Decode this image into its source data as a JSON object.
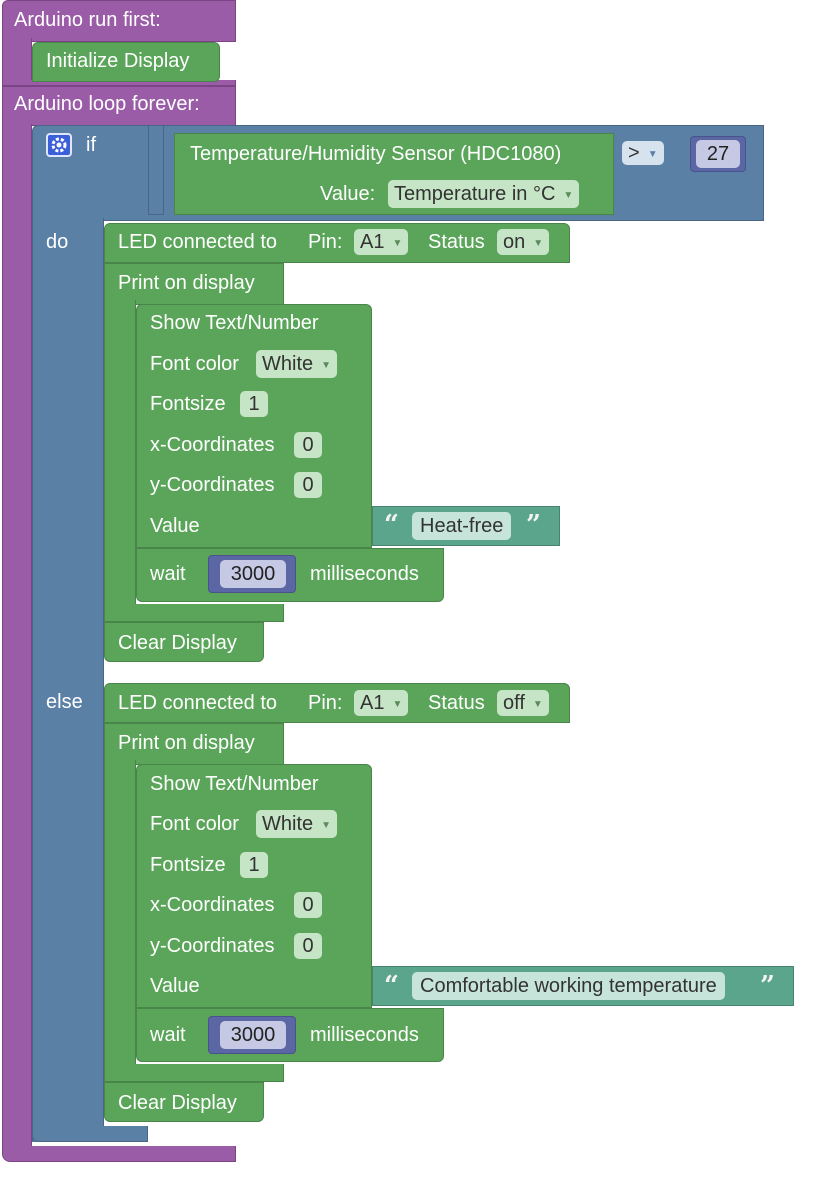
{
  "setup": {
    "label": "Arduino run first:",
    "init_label": "Initialize Display"
  },
  "loop": {
    "label": "Arduino loop forever:"
  },
  "if_block": {
    "if_label": "if",
    "do_label": "do",
    "else_label": "else",
    "condition": {
      "sensor_label": "Temperature/Humidity Sensor (HDC1080)",
      "value_label": "Value:",
      "value_option": "Temperature in °C",
      "operator": ">",
      "threshold": "27"
    }
  },
  "do_branch": {
    "led": {
      "label": "LED connected to",
      "pin_label": "Pin:",
      "pin": "A1",
      "status_label": "Status",
      "status": "on"
    },
    "print_label": "Print on display",
    "show": {
      "label": "Show Text/Number",
      "font_color_label": "Font color",
      "font_color": "White",
      "fontsize_label": "Fontsize",
      "fontsize": "1",
      "x_label": "x-Coordinates",
      "x": "0",
      "y_label": "y-Coordinates",
      "y": "0",
      "value_label": "Value",
      "text": "Heat-free"
    },
    "wait": {
      "label": "wait",
      "ms": "3000",
      "unit": "milliseconds"
    },
    "clear_label": "Clear Display"
  },
  "else_branch": {
    "led": {
      "label": "LED connected to",
      "pin_label": "Pin:",
      "pin": "A1",
      "status_label": "Status",
      "status": "off"
    },
    "print_label": "Print on display",
    "show": {
      "label": "Show Text/Number",
      "font_color_label": "Font color",
      "font_color": "White",
      "fontsize_label": "Fontsize",
      "fontsize": "1",
      "x_label": "x-Coordinates",
      "x": "0",
      "y_label": "y-Coordinates",
      "y": "0",
      "value_label": "Value",
      "text": "Comfortable working temperature"
    },
    "wait": {
      "label": "wait",
      "ms": "3000",
      "unit": "milliseconds"
    },
    "clear_label": "Clear Display"
  },
  "colors": {
    "purple": "#9a5ca6",
    "blue": "#5b80a5",
    "green": "#5ba55b",
    "text_green": "#5ba58c",
    "math": "#5b67a5",
    "mutator": "#3b5fd8"
  },
  "icons": {
    "mutator": "gear-icon",
    "dropdown": "dropdown-arrow-icon",
    "quote_open": "open-quote-icon",
    "quote_close": "close-quote-icon"
  }
}
